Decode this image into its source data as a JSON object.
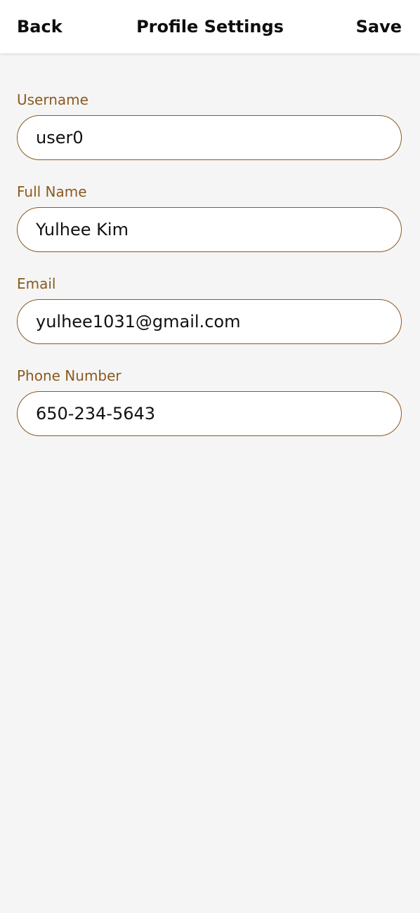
{
  "header": {
    "back_label": "Back",
    "title": "Profile Settings",
    "save_label": "Save"
  },
  "form": {
    "username": {
      "label": "Username",
      "value": "user0"
    },
    "full_name": {
      "label": "Full Name",
      "value": "Yulhee Kim"
    },
    "email": {
      "label": "Email",
      "value": "yulhee1031@gmail.com"
    },
    "phone": {
      "label": "Phone Number",
      "value": "650-234-5643"
    }
  },
  "colors": {
    "accent": "#8a5a1f",
    "background": "#f5f5f5",
    "header_bg": "#ffffff"
  }
}
